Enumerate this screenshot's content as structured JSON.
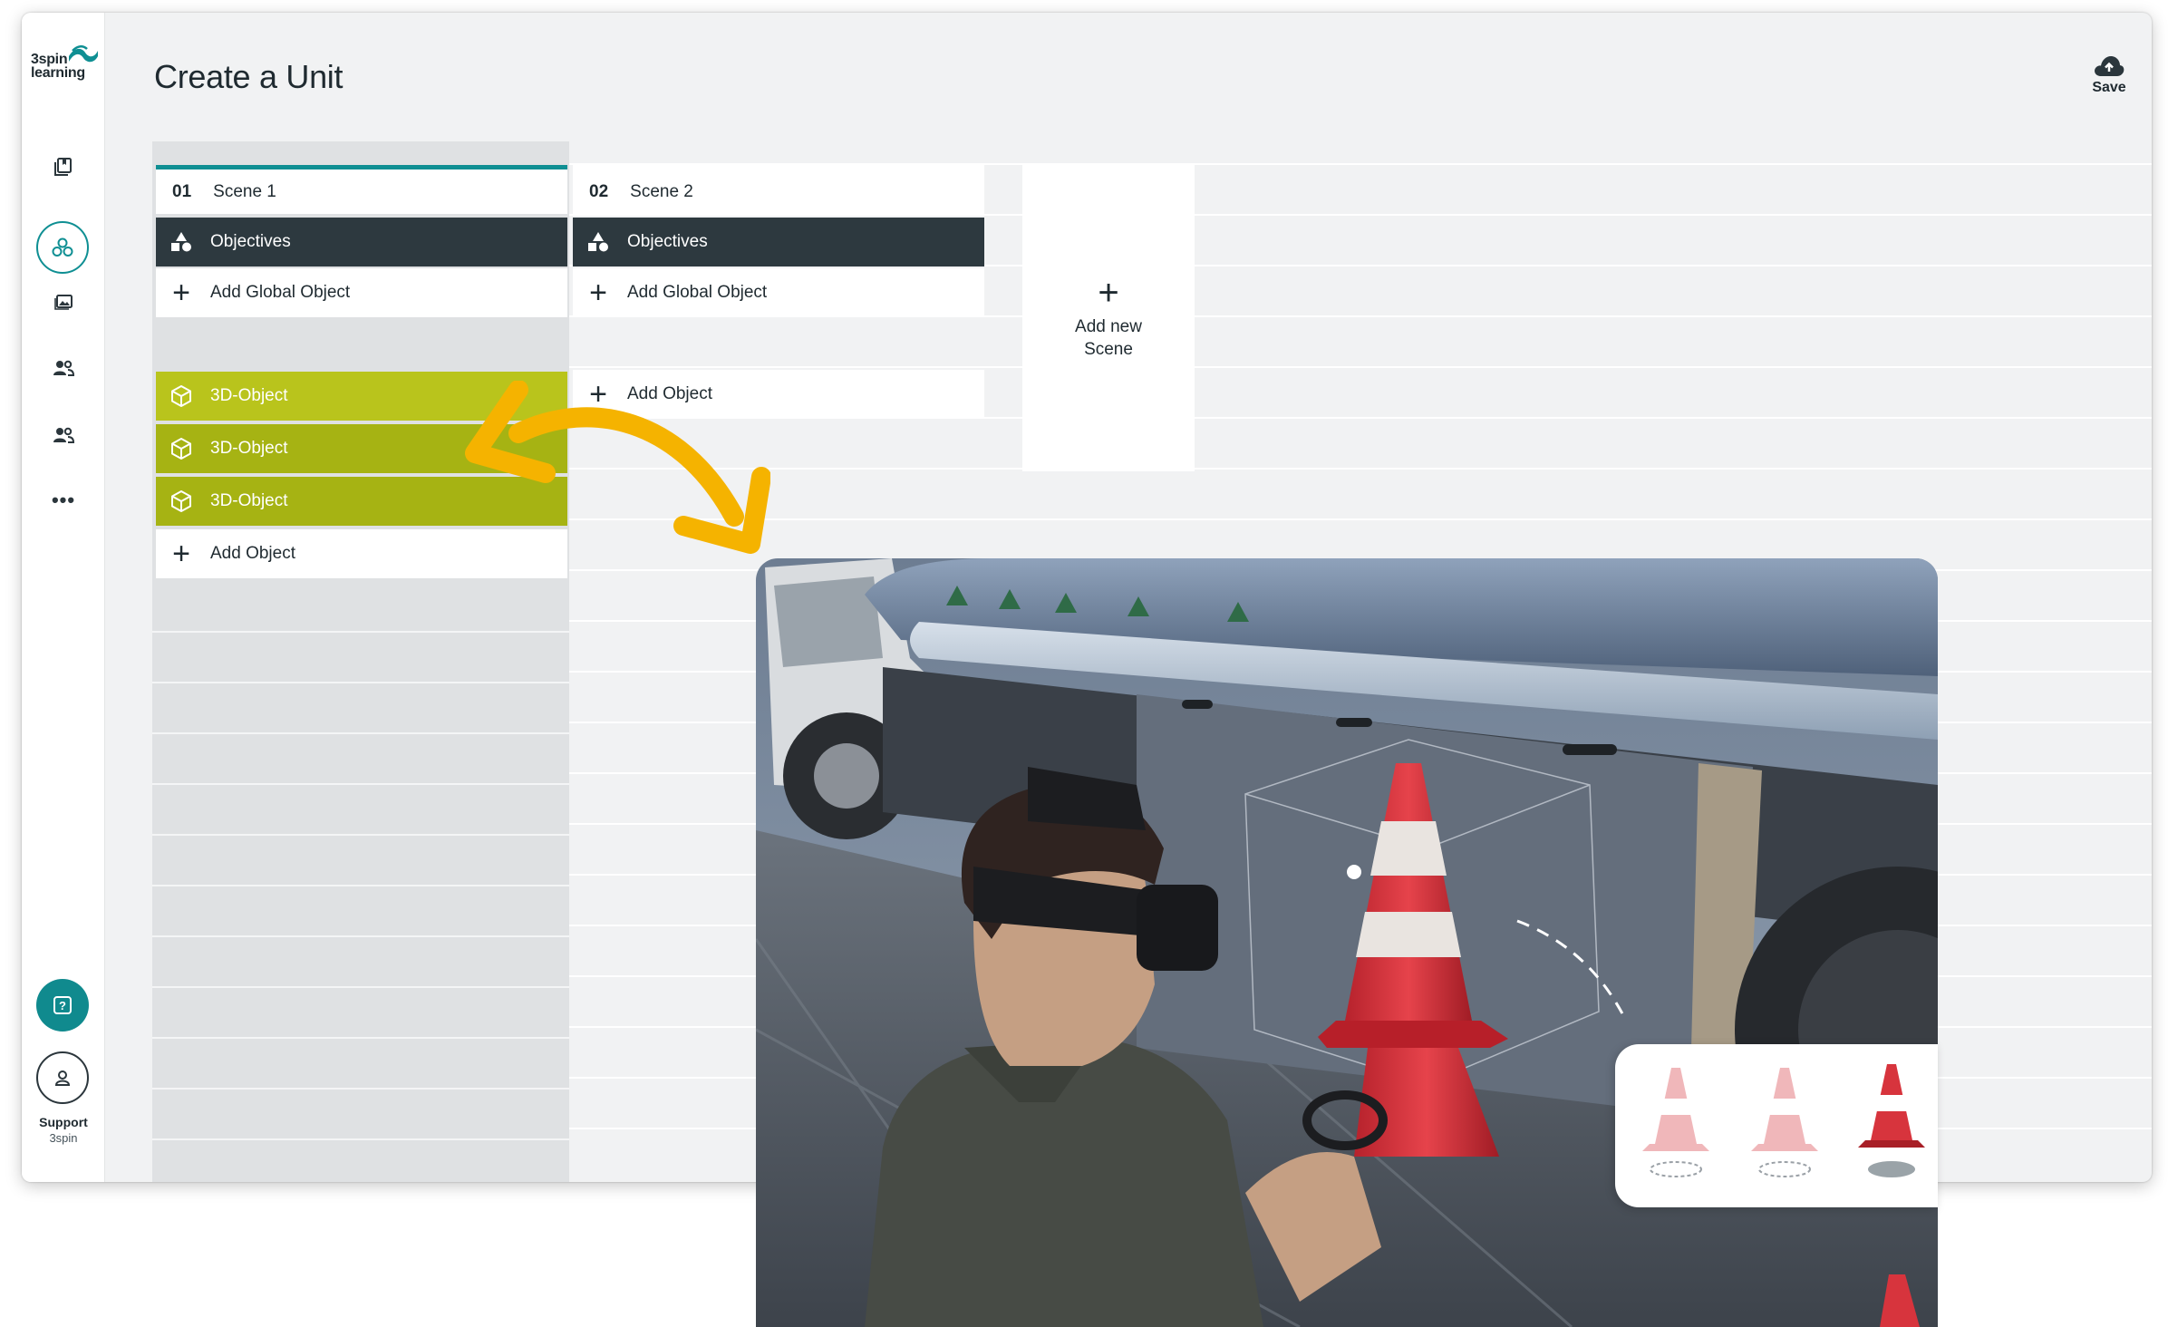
{
  "app": {
    "logo_line1": "3spin",
    "logo_line2": "learning",
    "title": "Create a Unit",
    "save_label": "Save",
    "support_label": "Support",
    "support_sub": "3spin",
    "more_label": "•••"
  },
  "colors": {
    "accent": "#0f8f93",
    "objectives_bg": "#2d393f",
    "object_bg": "#a6b313",
    "arrow": "#f5b300",
    "cone_red": "#d7343d"
  },
  "sidebar": {
    "icons": [
      "library-icon",
      "objects-icon",
      "media-icon",
      "users-icon",
      "groups-icon",
      "more-icon"
    ]
  },
  "scenes": [
    {
      "number": "01",
      "name": "Scene 1",
      "objectives_label": "Objectives",
      "add_global_label": "Add Global Object",
      "objects": [
        {
          "label": "3D-Object"
        },
        {
          "label": "3D-Object"
        },
        {
          "label": "3D-Object"
        }
      ],
      "add_object_label": "Add Object"
    },
    {
      "number": "02",
      "name": "Scene 2",
      "objectives_label": "Objectives",
      "add_global_label": "Add Global Object",
      "objects": [],
      "add_object_label": "Add Object"
    }
  ],
  "add_scene": {
    "plus": "+",
    "label": "Add new Scene"
  },
  "plus_glyph": "+"
}
